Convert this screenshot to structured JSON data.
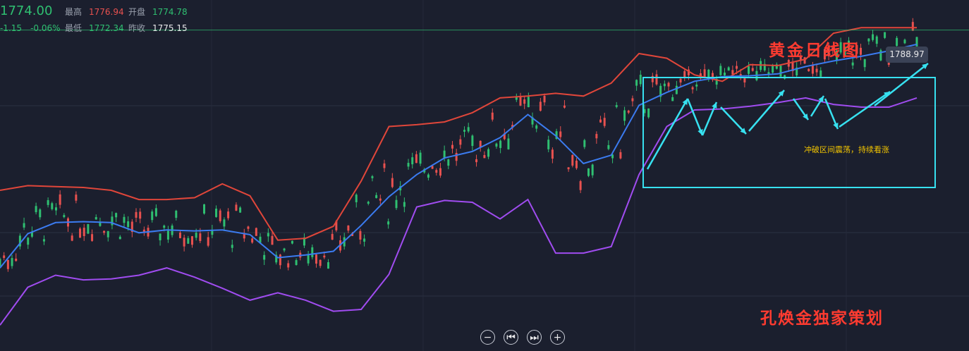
{
  "quote": {
    "price": "1774.00",
    "change": "-1.15",
    "change_pct": "-0.06%",
    "high_label": "最高",
    "high": "1776.94",
    "low_label": "最低",
    "low": "1772.34",
    "open_label": "开盘",
    "open": "1774.78",
    "prev_close_label": "昨收",
    "prev_close": "1775.15"
  },
  "annotations": {
    "title": "黄金日线图",
    "note": "冲破区间震荡，持续看涨",
    "signature": "孔焕金独家策划",
    "last_price_tag": "1788.97"
  },
  "controls": {
    "zoom_out": "−",
    "prev": "⏮",
    "next": "⏭",
    "zoom_in": "+"
  },
  "colors": {
    "background": "#1b1f2e",
    "up": "#e8514f",
    "down": "#2fbf71",
    "upper_band": "#e0463a",
    "middle_band": "#3b7bf0",
    "lower_band": "#a04cf0",
    "annotation_box": "#37e1f0",
    "handwriting": "#ff3b30",
    "note_text": "#f2c400"
  },
  "chart_data": {
    "type": "candlestick",
    "indicator": "Bollinger Bands",
    "ylim": [
      1440,
      1820
    ],
    "last_price": 1788.97,
    "series": [
      {
        "name": "upper",
        "values": [
          1614,
          1619,
          1618,
          1617,
          1614,
          1604,
          1604,
          1606,
          1621,
          1608,
          1560,
          1562,
          1575,
          1624,
          1683,
          1685,
          1688,
          1698,
          1714,
          1716,
          1719,
          1716,
          1730,
          1762,
          1757,
          1739,
          1732,
          1750,
          1749,
          1756,
          1784,
          1790,
          1790,
          1790
        ]
      },
      {
        "name": "middle",
        "values": [
          1530,
          1567,
          1579,
          1580,
          1579,
          1568,
          1571,
          1570,
          1571,
          1566,
          1541,
          1544,
          1548,
          1576,
          1607,
          1631,
          1649,
          1656,
          1671,
          1696,
          1673,
          1643,
          1652,
          1706,
          1720,
          1732,
          1737,
          1738,
          1740,
          1748,
          1754,
          1759,
          1765,
          1772
        ]
      },
      {
        "name": "lower",
        "values": [
          1468,
          1509,
          1522,
          1517,
          1518,
          1522,
          1530,
          1520,
          1508,
          1495,
          1503,
          1495,
          1483,
          1485,
          1523,
          1596,
          1603,
          1601,
          1583,
          1604,
          1546,
          1546,
          1553,
          1631,
          1683,
          1701,
          1702,
          1705,
          1709,
          1714,
          1707,
          1704,
          1704,
          1714
        ]
      }
    ]
  }
}
